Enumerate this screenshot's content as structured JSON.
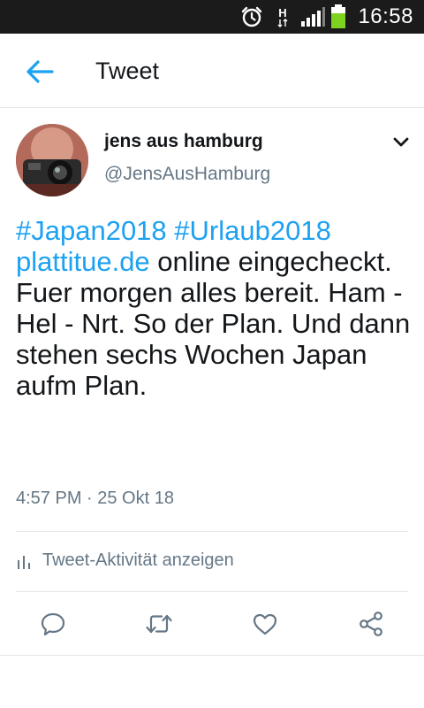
{
  "status_bar": {
    "time": "16:58",
    "network_label": "H",
    "icons": [
      "alarm-clock-icon",
      "network-type-icon",
      "signal-icon",
      "battery-icon"
    ],
    "battery_color": "#7ed321"
  },
  "app_bar": {
    "title": "Tweet",
    "back_icon": "arrow-left-icon",
    "accent": "#1da1f2"
  },
  "tweet": {
    "author_name": "jens aus hamburg",
    "author_handle": "@JensAusHamburg",
    "text_segments": [
      {
        "text": "#Japan2018",
        "link": true
      },
      {
        "text": " ",
        "link": false
      },
      {
        "text": "#Urlaub2018",
        "link": true
      },
      {
        "text": "\n",
        "link": false
      },
      {
        "text": "plattitue.de",
        "link": true
      },
      {
        "text": "  online eingecheckt. Fuer morgen alles bereit. Ham - Hel - Nrt. So der Plan. Und dann stehen sechs Wochen Japan aufm Plan.",
        "link": false
      }
    ],
    "timestamp": "4:57 PM · 25 Okt 18",
    "activity_label": "Tweet-Aktivität anzeigen"
  },
  "actions": [
    {
      "name": "reply-icon"
    },
    {
      "name": "retweet-icon"
    },
    {
      "name": "like-icon"
    },
    {
      "name": "share-icon"
    }
  ],
  "colors": {
    "text": "#14171a",
    "secondary": "#657786",
    "link": "#1da1f2",
    "divider": "#e1e8ed"
  }
}
